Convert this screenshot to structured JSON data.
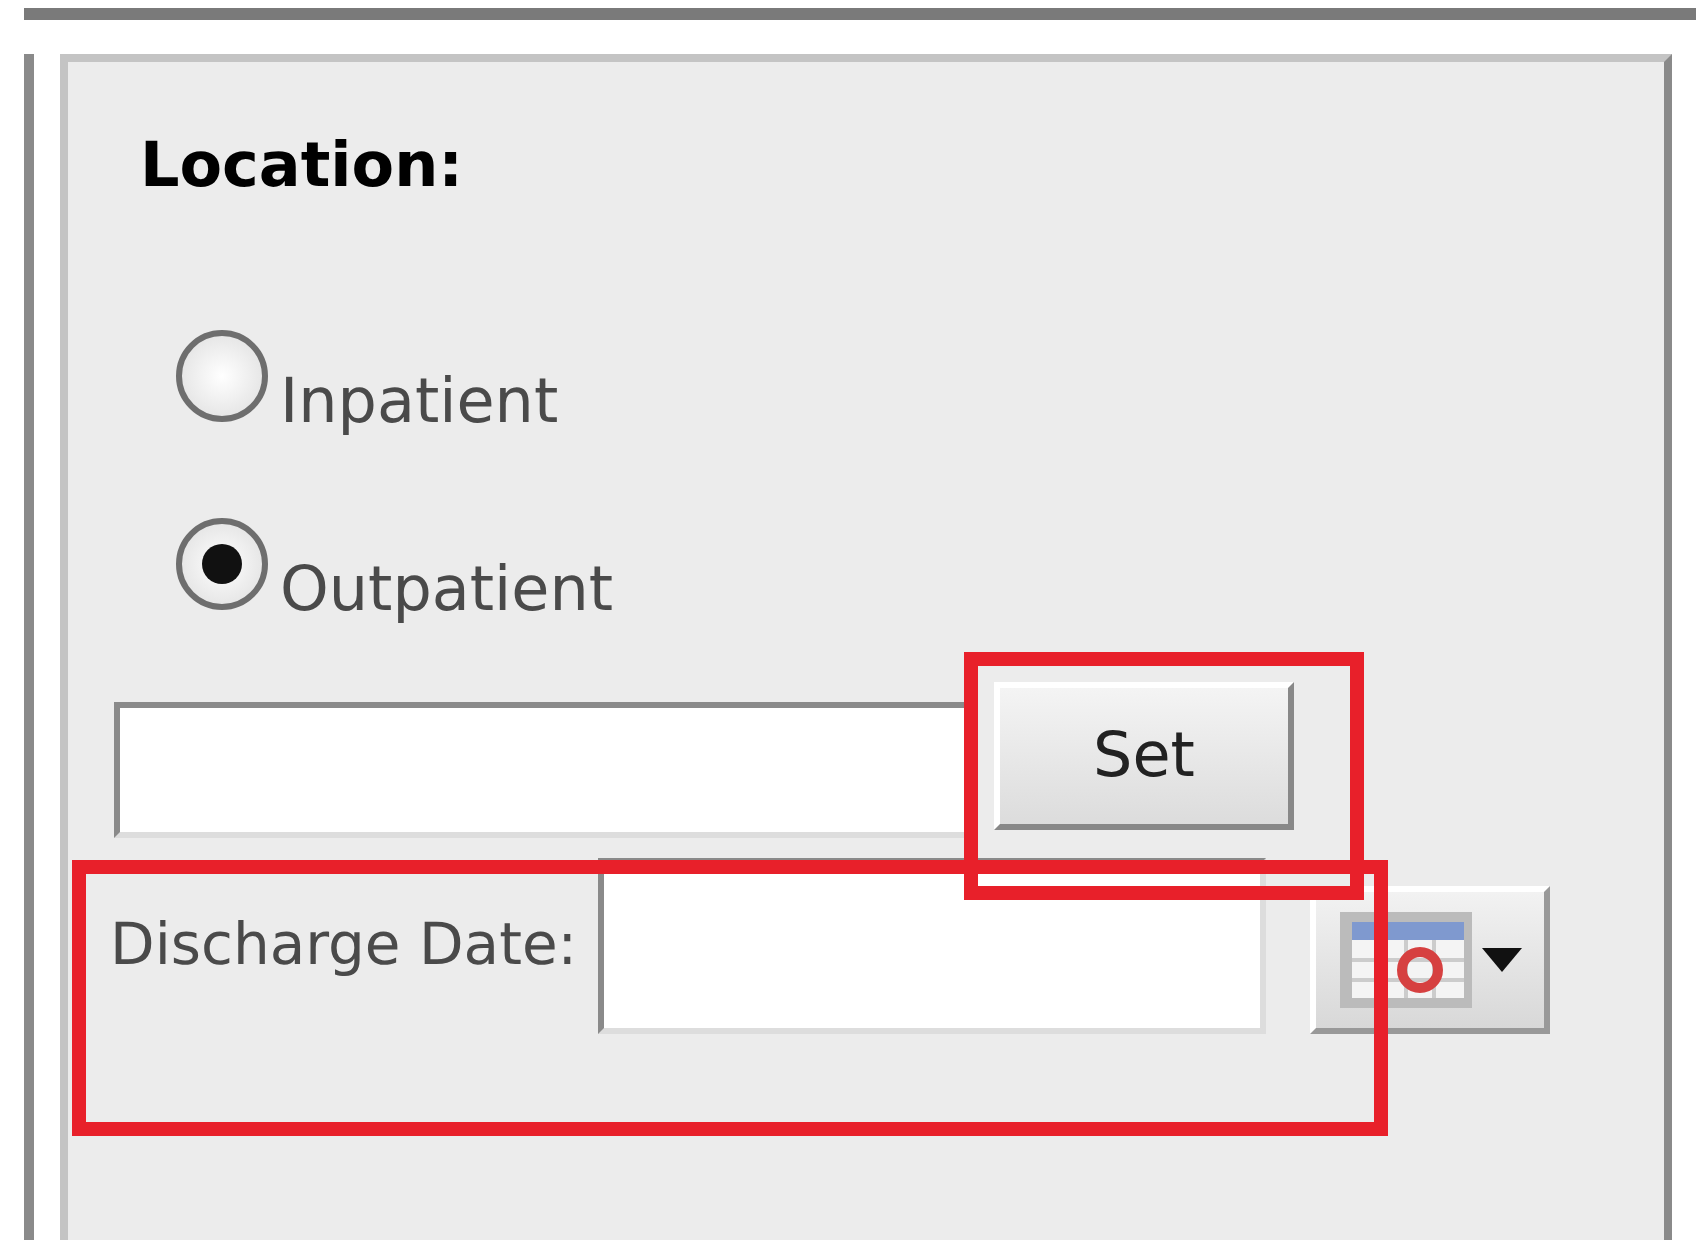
{
  "heading": "Location:",
  "location_options": [
    {
      "label": "Inpatient",
      "selected": false
    },
    {
      "label": "Outpatient",
      "selected": true
    }
  ],
  "set_button": "Set",
  "discharge_date": {
    "label": "Discharge Date:"
  }
}
